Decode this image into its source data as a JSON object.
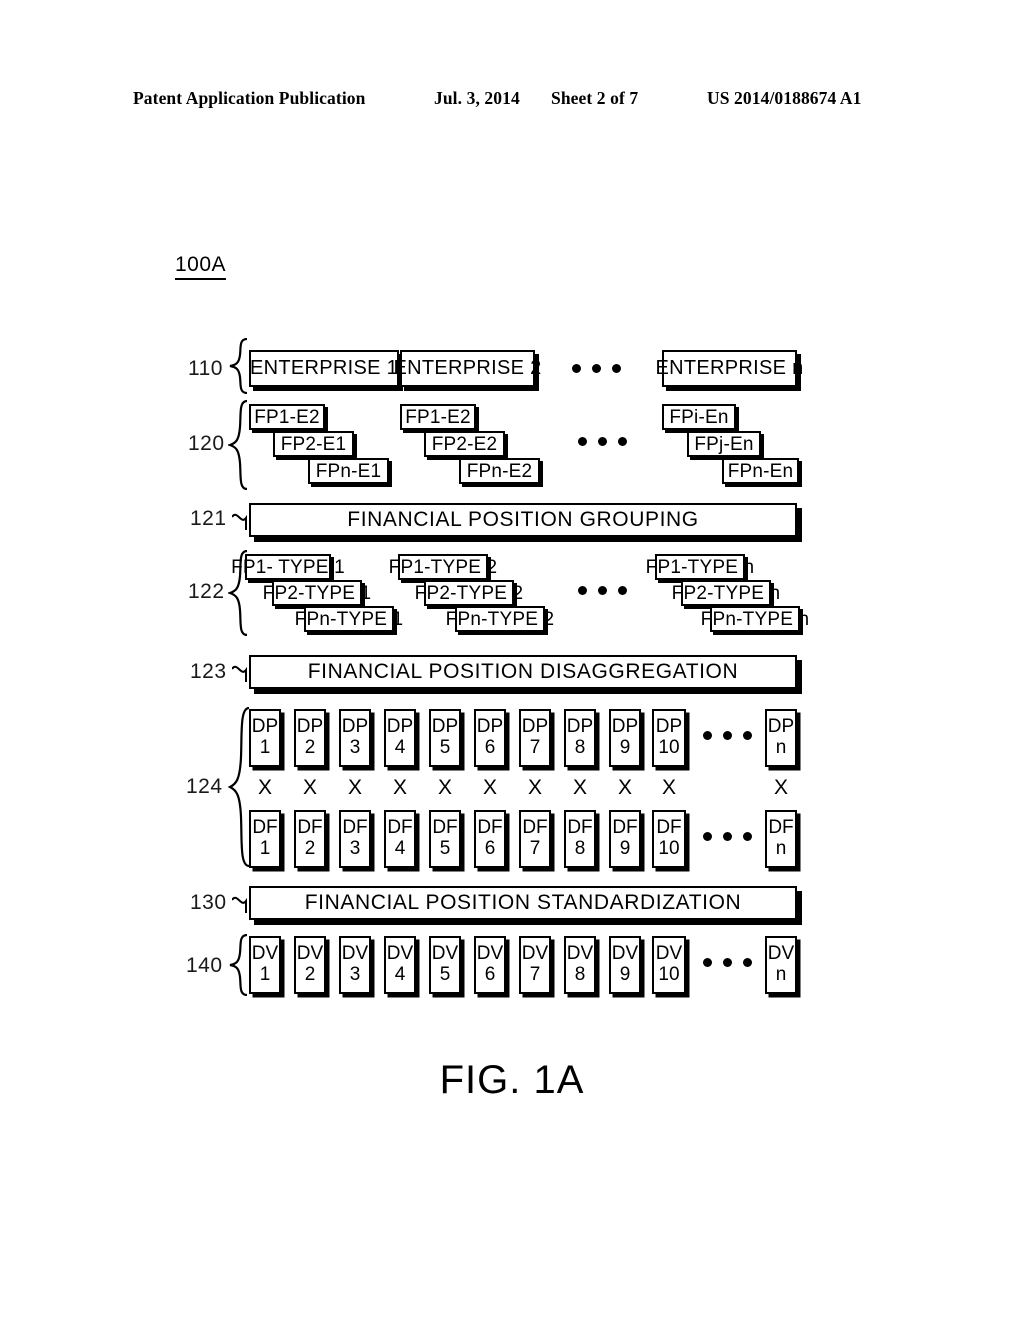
{
  "page_header": {
    "publication": "Patent Application Publication",
    "date": "Jul. 3, 2014",
    "sheet": "Sheet 2 of 7",
    "patent_number": "US 2014/0188674 A1"
  },
  "figure": {
    "id_label": "100A",
    "caption": "FIG. 1A",
    "ellipsis": "•••",
    "rows": {
      "enterprises": {
        "ref": "110",
        "boxes": [
          {
            "label": "ENTERPRISE 1"
          },
          {
            "label": "ENTERPRISE 2"
          },
          {
            "label": "ENTERPRISE n"
          }
        ]
      },
      "financial_positions": {
        "ref": "120",
        "stacks": [
          {
            "items": [
              "FP1-E2",
              "FP2-E1",
              "FPn-E1"
            ]
          },
          {
            "items": [
              "FP1-E2",
              "FP2-E2",
              "FPn-E2"
            ]
          },
          {
            "items": [
              "FPi-En",
              "FPj-En",
              "FPn-En"
            ]
          }
        ]
      },
      "grouping_bar": {
        "ref": "121",
        "label": "FINANCIAL POSITION GROUPING"
      },
      "position_types": {
        "ref": "122",
        "stacks": [
          {
            "items": [
              "FP1- TYPE 1",
              "FP2-TYPE 1",
              "FPn-TYPE 1"
            ]
          },
          {
            "items": [
              "FP1-TYPE 2",
              "FP2-TYPE 2",
              "FPn-TYPE 2"
            ]
          },
          {
            "items": [
              "FP1-TYPE n",
              "FP2-TYPE n",
              "FPn-TYPE n"
            ]
          }
        ]
      },
      "disaggregation_bar": {
        "ref": "123",
        "label": "FINANCIAL POSITION DISAGGREGATION"
      },
      "disaggregated": {
        "ref": "124",
        "multiplier": "X",
        "dp_prefix": "DP",
        "df_prefix": "DF",
        "indices": [
          "1",
          "2",
          "3",
          "4",
          "5",
          "6",
          "7",
          "8",
          "9",
          "10"
        ],
        "tail_index": "n"
      },
      "standardization_bar": {
        "ref": "130",
        "label": "FINANCIAL POSITION STANDARDIZATION"
      },
      "standardized": {
        "ref": "140",
        "dv_prefix": "DV",
        "indices": [
          "1",
          "2",
          "3",
          "4",
          "5",
          "6",
          "7",
          "8",
          "9",
          "10"
        ],
        "tail_index": "n"
      }
    }
  },
  "colors": {
    "ink": "#000000",
    "paper": "#ffffff"
  }
}
